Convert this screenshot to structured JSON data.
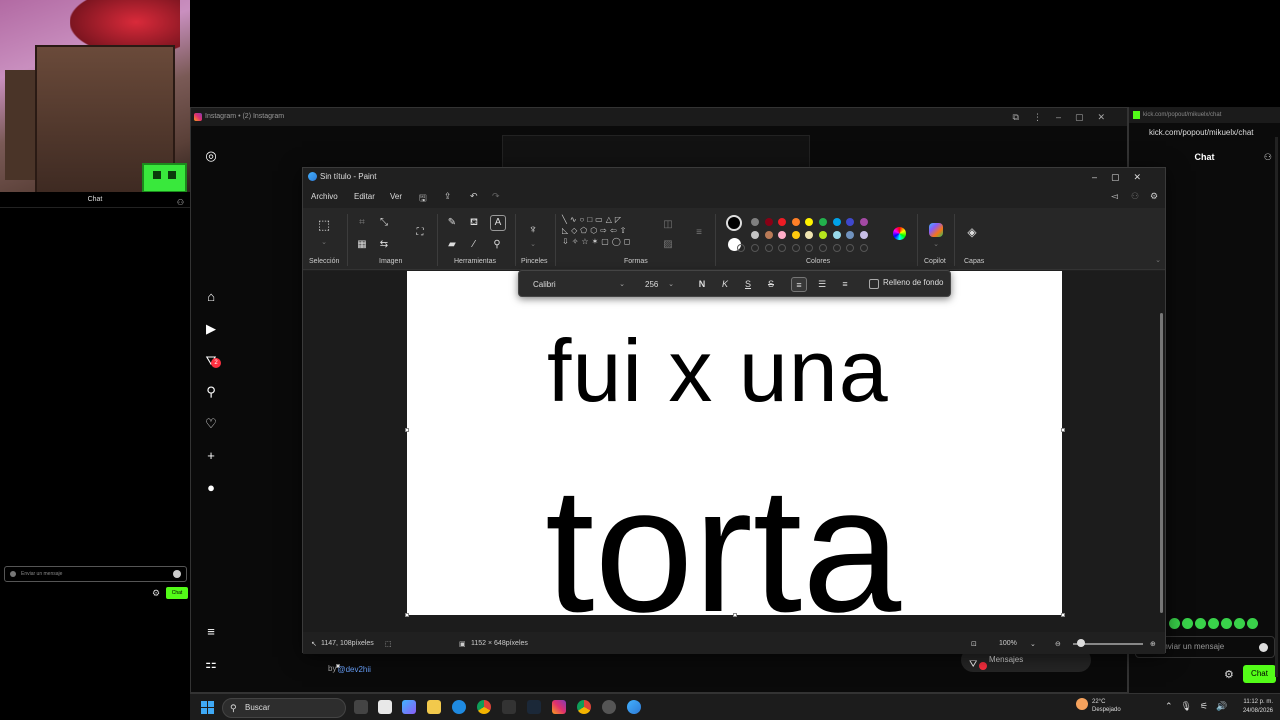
{
  "left_stream": {
    "chat_title": "Chat",
    "input_placeholder": "Enviar un mensaje",
    "chat_button": "Chat"
  },
  "instagram": {
    "window_title": "Instagram • (2) Instagram",
    "notification_count": "2",
    "footer_prefix": "by ",
    "footer_handle": "@dev2hii",
    "messages_label": "Mensajes"
  },
  "kick": {
    "window_title": "kick.com/popout/mikuelx/chat",
    "url": "kick.com/popout/mikuelx/chat",
    "chat_title": "Chat",
    "input_placeholder": "Enviar un mensaje",
    "chat_button": "Chat"
  },
  "paint": {
    "title": "Sin título - Paint",
    "menu": {
      "file": "Archivo",
      "edit": "Editar",
      "view": "Ver"
    },
    "groups": {
      "selection": "Selección",
      "image": "Imagen",
      "tools": "Herramientas",
      "brushes": "Pinceles",
      "shapes": "Formas",
      "colors": "Colores",
      "copilot": "Copilot",
      "layers": "Capas"
    },
    "text_toolbar": {
      "font": "Calibri",
      "size": "256",
      "bold": "N",
      "italic": "K",
      "underline": "S",
      "strike": "S",
      "fill_label": "Relleno de fondo"
    },
    "canvas_text": {
      "line1": "fui x una",
      "line2": "torta"
    },
    "status": {
      "cursor": "1147, 108píxeles",
      "dimensions": "1152 × 648píxeles",
      "zoom": "100%"
    },
    "colors": {
      "row1": [
        "#000000",
        "#7f7f7f",
        "#880015",
        "#ed1c24",
        "#ff7f27",
        "#fff200",
        "#22b14c",
        "#00a2e8",
        "#3f48cc",
        "#a349a4"
      ],
      "row2": [
        "#ffffff",
        "#c3c3c3",
        "#b97a57",
        "#ffaec9",
        "#ffc90e",
        "#efe4b0",
        "#b5e61d",
        "#99d9ea",
        "#7092be",
        "#c8bfe7"
      ]
    }
  },
  "taskbar": {
    "search_label": "Buscar",
    "weather_temp": "22°C",
    "weather_desc": "Despejado",
    "time": "11:12 p. m.",
    "date": "24/08/2026"
  }
}
